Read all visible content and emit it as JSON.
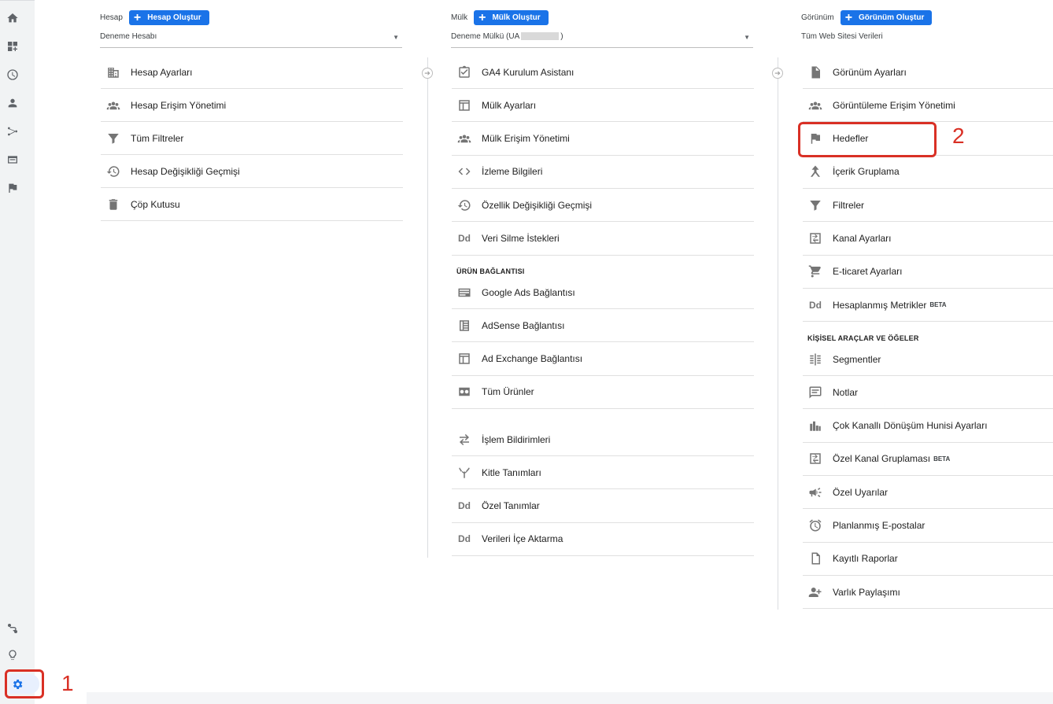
{
  "annotations": {
    "one": "1",
    "two": "2"
  },
  "account": {
    "label": "Hesap",
    "create": "Hesap Oluştur",
    "selected": "Deneme Hesabı",
    "items": [
      {
        "icon": "building-icon",
        "label": "Hesap Ayarları"
      },
      {
        "icon": "people-icon",
        "label": "Hesap Erişim Yönetimi"
      },
      {
        "icon": "filter-icon",
        "label": "Tüm Filtreler"
      },
      {
        "icon": "history-icon",
        "label": "Hesap Değişikliği Geçmişi"
      },
      {
        "icon": "trash-icon",
        "label": "Çöp Kutusu"
      }
    ]
  },
  "property": {
    "label": "Mülk",
    "create": "Mülk Oluştur",
    "selected_prefix": "Deneme Mülkü (UA",
    "selected_suffix": ")",
    "items": [
      {
        "icon": "checklist-icon",
        "label": "GA4 Kurulum Asistanı"
      },
      {
        "icon": "window-icon",
        "label": "Mülk Ayarları"
      },
      {
        "icon": "people-icon",
        "label": "Mülk Erişim Yönetimi"
      },
      {
        "icon": "code-icon",
        "label": "İzleme Bilgileri"
      },
      {
        "icon": "history-icon",
        "label": "Özellik Değişikliği Geçmişi"
      },
      {
        "icon": "dd-icon",
        "label": "Veri Silme İstekleri"
      }
    ],
    "product_section": "ÜRÜN BAĞLANTISI",
    "product_items": [
      {
        "icon": "ads-icon",
        "label": "Google Ads Bağlantısı"
      },
      {
        "icon": "adsense-icon",
        "label": "AdSense Bağlantısı"
      },
      {
        "icon": "window-icon",
        "label": "Ad Exchange Bağlantısı"
      },
      {
        "icon": "link-icon",
        "label": "Tüm Ürünler"
      }
    ],
    "other_items": [
      {
        "icon": "postbacks-icon",
        "label": "İşlem Bildirimleri"
      },
      {
        "icon": "audience-icon",
        "label": "Kitle Tanımları"
      },
      {
        "icon": "dd-icon",
        "label": "Özel Tanımlar"
      },
      {
        "icon": "dd-icon",
        "label": "Verileri İçe Aktarma"
      }
    ]
  },
  "view": {
    "label": "Görünüm",
    "create": "Görünüm Oluştur",
    "selected": "Tüm Web Sitesi Verileri",
    "items": [
      {
        "icon": "document-icon",
        "label": "Görünüm Ayarları"
      },
      {
        "icon": "people-icon",
        "label": "Görüntüleme Erişim Yönetimi"
      },
      {
        "icon": "flag-icon",
        "label": "Hedefler"
      },
      {
        "icon": "grouping-icon",
        "label": "İçerik Gruplama"
      },
      {
        "icon": "filter-icon",
        "label": "Filtreler"
      },
      {
        "icon": "channel-icon",
        "label": "Kanal Ayarları"
      },
      {
        "icon": "cart-icon",
        "label": "E-ticaret Ayarları"
      },
      {
        "icon": "dd-icon",
        "label": "Hesaplanmış Metrikler",
        "badge": "BETA"
      }
    ],
    "personal_section": "KİŞİSEL ARAÇLAR VE ÖĞELER",
    "personal_items": [
      {
        "icon": "segments-icon",
        "label": "Segmentler"
      },
      {
        "icon": "notes-icon",
        "label": "Notlar"
      },
      {
        "icon": "bar-chart-icon",
        "label": "Çok Kanallı Dönüşüm Hunisi Ayarları"
      },
      {
        "icon": "channel-icon",
        "label": "Özel Kanal Gruplaması",
        "badge": "BETA"
      },
      {
        "icon": "megaphone-icon",
        "label": "Özel Uyarılar"
      },
      {
        "icon": "alarm-icon",
        "label": "Planlanmış E-postalar"
      },
      {
        "icon": "saved-report-icon",
        "label": "Kayıtlı Raporlar"
      },
      {
        "icon": "person-add-icon",
        "label": "Varlık Paylaşımı"
      }
    ]
  },
  "colors": {
    "accent": "#1a73e8",
    "annotation": "#d93025",
    "rail": "#f1f3f4"
  }
}
